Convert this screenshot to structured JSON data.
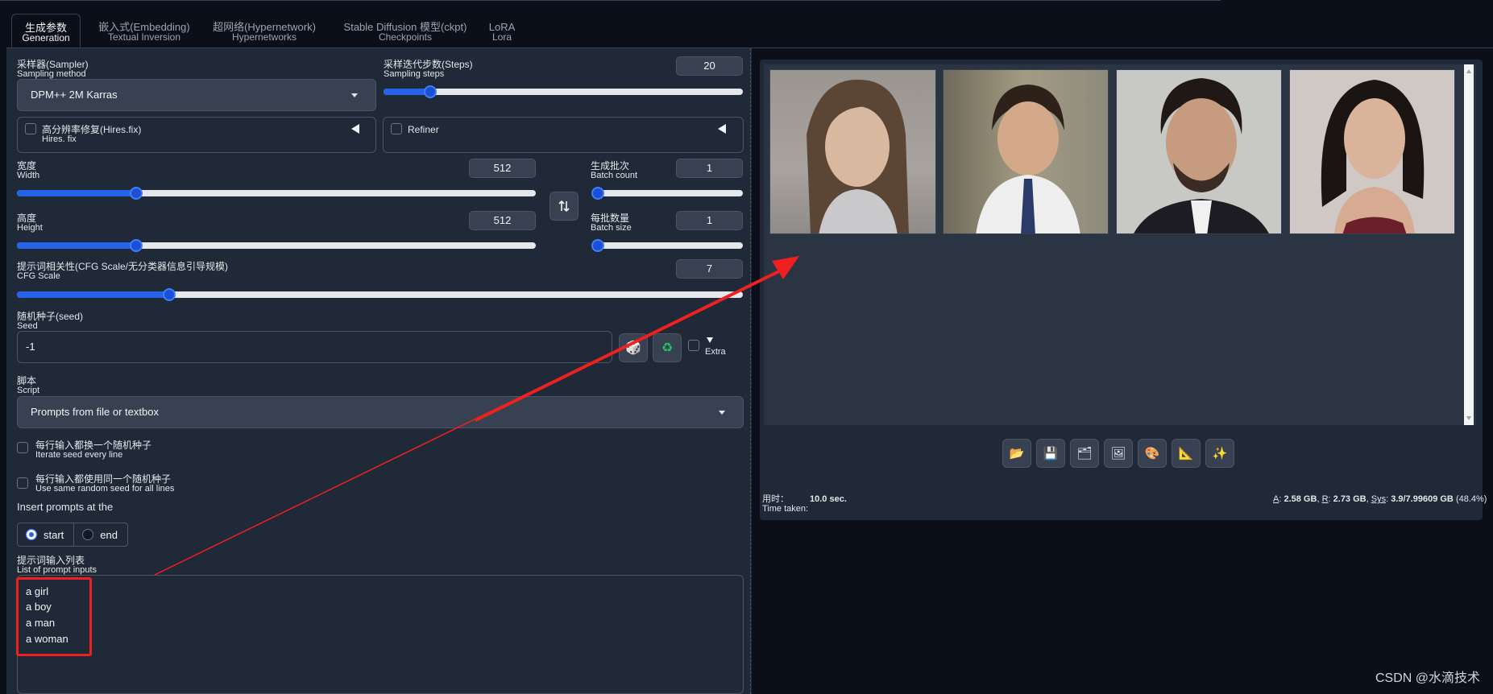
{
  "tabs": [
    {
      "cn": "生成参数",
      "en": "Generation"
    },
    {
      "cn": "嵌入式(Embedding)",
      "en": "Textual Inversion"
    },
    {
      "cn": "超网络(Hypernetwork)",
      "en": "Hypernetworks"
    },
    {
      "cn": "Stable Diffusion 模型(ckpt)",
      "en": "Checkpoints"
    },
    {
      "cn": "LoRA",
      "en": "Lora"
    }
  ],
  "sampler": {
    "label_cn": "采样器(Sampler)",
    "label_en": "Sampling method",
    "value": "DPM++ 2M Karras"
  },
  "steps": {
    "label_cn": "采样迭代步数(Steps)",
    "label_en": "Sampling steps",
    "value": "20",
    "fraction": 0.13
  },
  "hires": {
    "label_cn": "高分辨率修复(Hires.fix)",
    "label_en": "Hires. fix"
  },
  "refiner": {
    "label": "Refiner"
  },
  "width": {
    "label_cn": "宽度",
    "label_en": "Width",
    "value": "512",
    "fraction": 0.23
  },
  "height": {
    "label_cn": "高度",
    "label_en": "Height",
    "value": "512",
    "fraction": 0.23
  },
  "batch_count": {
    "label_cn": "生成批次",
    "label_en": "Batch count",
    "value": "1",
    "fraction": 0.0
  },
  "batch_size": {
    "label_cn": "每批数量",
    "label_en": "Batch size",
    "value": "1",
    "fraction": 0.0
  },
  "cfg": {
    "label_cn": "提示词相关性(CFG Scale/无分类器信息引导规模)",
    "label_en": "CFG Scale",
    "value": "7",
    "fraction": 0.21
  },
  "seed": {
    "label_cn": "随机种子(seed)",
    "label_en": "Seed",
    "value": "-1",
    "extra": "Extra"
  },
  "script": {
    "label_cn": "脚本",
    "label_en": "Script",
    "value": "Prompts from file or textbox"
  },
  "iterate_seed": {
    "label_cn": "每行输入都换一个随机种子",
    "label_en": "Iterate seed every line"
  },
  "same_seed": {
    "label_cn": "每行输入都使用同一个随机种子",
    "label_en": "Use same random seed for all lines"
  },
  "insert_at": {
    "label": "Insert prompts at the",
    "options": [
      "start",
      "end"
    ],
    "selected": "start"
  },
  "prompt_list": {
    "label_cn": "提示词输入列表",
    "label_en": "List of prompt inputs",
    "lines": [
      "a girl",
      "a boy",
      "a man",
      "a woman"
    ]
  },
  "timing": {
    "label_cn": "用时：",
    "label_en": "Time taken:",
    "value": "10.0 sec."
  },
  "memory": {
    "a_label": "A",
    "a_value": "2.58 GB",
    "r_label": "R",
    "r_value": "2.73 GB",
    "sys_label": "Sys",
    "sys_value": "3.9/7.99609 GB",
    "sys_pct": "(48.4%)"
  },
  "action_icons": [
    "folder-icon",
    "save-icon",
    "zip-icon",
    "image-icon",
    "palette-icon",
    "ruler-icon",
    "sparkle-icon"
  ],
  "watermark": "CSDN @水滴技术",
  "colors": {
    "accent": "#2563eb",
    "panel": "#1f2937",
    "background": "#0b0f19",
    "highlight": "#ef2020"
  }
}
